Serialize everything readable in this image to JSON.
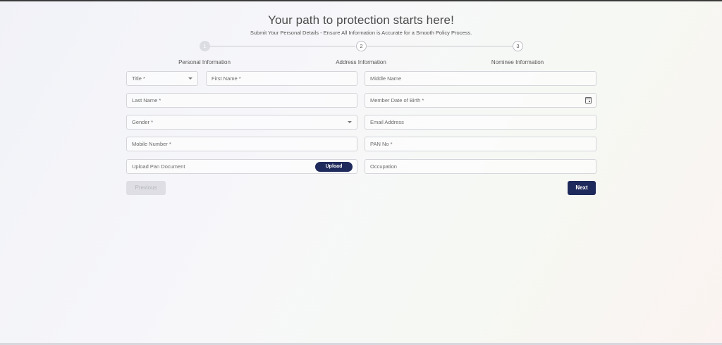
{
  "header": {
    "title": "Your path to protection starts here!",
    "subtitle": "Submit Your Personal Details - Ensure All Information is Accurate for a Smooth Policy Process."
  },
  "steps": [
    {
      "number": "1",
      "label": "Personal Information",
      "state": "active"
    },
    {
      "number": "2",
      "label": "Address Information",
      "state": "pending"
    },
    {
      "number": "3",
      "label": "Nominee Information",
      "state": "pending"
    }
  ],
  "form": {
    "title_placeholder": "Title *",
    "first_name_placeholder": "First Name *",
    "middle_name_placeholder": "Middle Name",
    "last_name_placeholder": "Last Name *",
    "dob_placeholder": "Member Date of Birth *",
    "gender_placeholder": "Gender *",
    "email_placeholder": "Email Address",
    "mobile_placeholder": "Mobile Number *",
    "pan_placeholder": "PAN No *",
    "upload_pan_label": "Upload Pan Document",
    "upload_button_label": "Upload",
    "occupation_placeholder": "Occupation"
  },
  "nav": {
    "previous_label": "Previous",
    "next_label": "Next"
  },
  "colors": {
    "primary": "#1f2a5c",
    "disabled": "#dedee4"
  }
}
